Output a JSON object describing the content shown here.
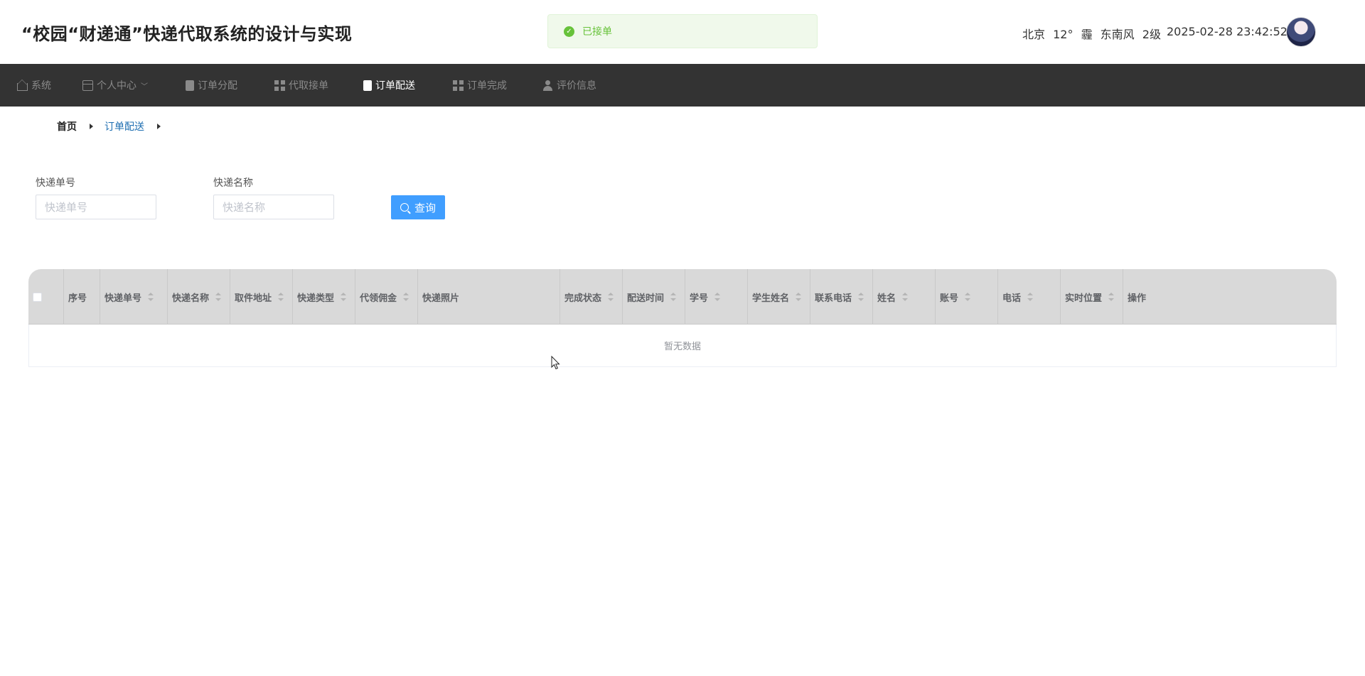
{
  "header": {
    "title": "“校园“财递通”快递代取系统的设计与实现",
    "weather": {
      "city": "北京",
      "temp": "12°",
      "condition": "霾",
      "wind": "东南风",
      "level": "2级"
    },
    "datetime": "2025-02-28 23:42:52"
  },
  "toast": {
    "message": "已接单",
    "type": "success",
    "color": "#67c23a"
  },
  "nav": {
    "items": [
      {
        "label": "系统",
        "icon": "home-icon",
        "active": false
      },
      {
        "label": "个人中心",
        "icon": "card-icon",
        "active": false,
        "has_dropdown": true
      },
      {
        "label": "订单分配",
        "icon": "clipboard-icon",
        "active": false
      },
      {
        "label": "代取接单",
        "icon": "grid-icon",
        "active": false
      },
      {
        "label": "订单配送",
        "icon": "clipboard-icon",
        "active": true
      },
      {
        "label": "订单完成",
        "icon": "grid-icon",
        "active": false
      },
      {
        "label": "评价信息",
        "icon": "user-icon",
        "active": false
      }
    ]
  },
  "breadcrumb": {
    "home": "首页",
    "current": "订单配送"
  },
  "search": {
    "tracking_label": "快递单号",
    "tracking_placeholder": "快递单号",
    "tracking_value": "",
    "name_label": "快递名称",
    "name_placeholder": "快递名称",
    "name_value": "",
    "button_label": "查询",
    "button_color": "#409eff"
  },
  "table": {
    "columns": [
      "序号",
      "快递单号",
      "快递名称",
      "取件地址",
      "快递类型",
      "代领佣金",
      "快递照片",
      "完成状态",
      "配送时间",
      "学号",
      "学生姓名",
      "联系电话",
      "姓名",
      "账号",
      "电话",
      "实时位置",
      "操作"
    ],
    "rows": [],
    "empty_text": "暂无数据"
  },
  "colors": {
    "nav_bg": "#333333",
    "header_row_bg": "#d9d9d9",
    "active_link": "#1f6fb2"
  }
}
